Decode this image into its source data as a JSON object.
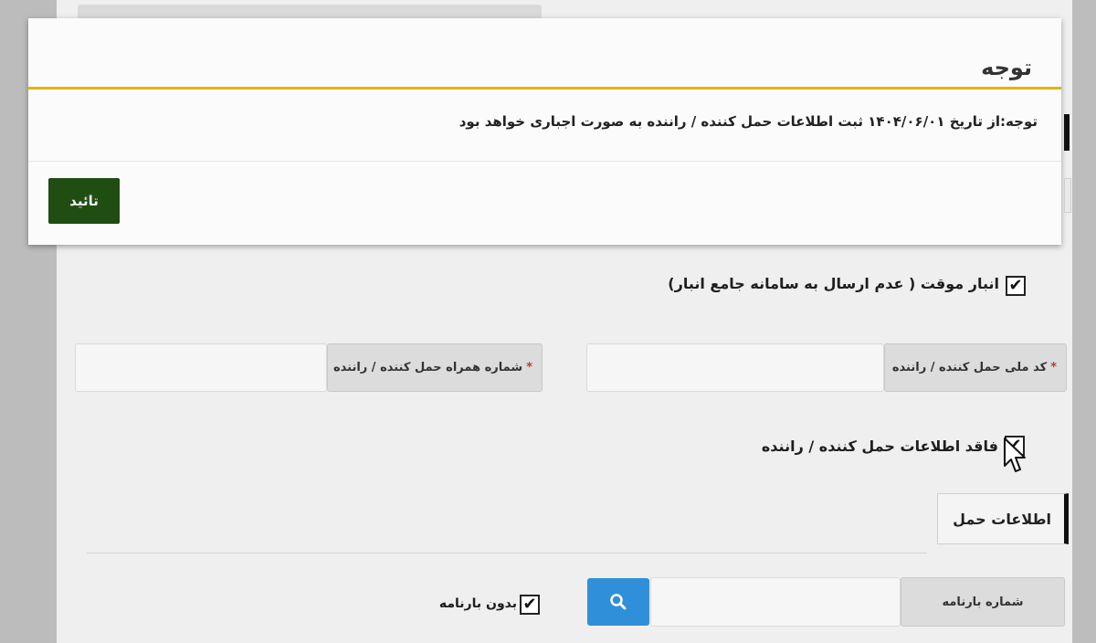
{
  "modal": {
    "title": "توجه",
    "message": "توجه:از تاریخ ۱۴۰۴/۰۶/۰۱ ثبت اطلاعات حمل کننده / راننده به صورت اجباری خواهد بود",
    "confirm_label": "تائید",
    "accent_color": "#e2b400",
    "button_color": "#1f4d12"
  },
  "form": {
    "temp_warehouse": {
      "label": "انبار موقت ( عدم ارسال به سامانه جامع انبار)",
      "checked": true
    },
    "national_id": {
      "label": "کد ملی حمل کننده / راننده",
      "required": "*",
      "value": ""
    },
    "mobile": {
      "label": "شماره همراه حمل کننده / راننده",
      "required": "*",
      "value": ""
    },
    "no_driver_info": {
      "label": "فاقد اطلاعات حمل کننده / راننده",
      "checked": true
    },
    "section_title": "اطلاعات حمل",
    "waybill": {
      "label": "شماره بارنامه",
      "value": ""
    },
    "no_waybill": {
      "label": "بدون بارنامه",
      "checked": true
    },
    "check_glyph": "✔",
    "search_color": "#2f8fd8"
  }
}
